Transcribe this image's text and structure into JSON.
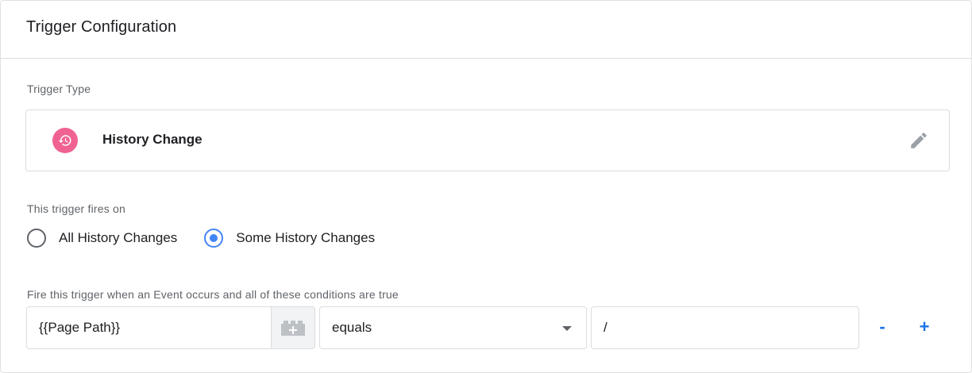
{
  "card": {
    "title": "Trigger Configuration"
  },
  "trigger_type": {
    "label": "Trigger Type",
    "name": "History Change",
    "icon": "history-icon",
    "icon_color": "#f06292",
    "edit_icon": "pencil-icon"
  },
  "fires_on": {
    "label": "This trigger fires on",
    "options": [
      {
        "label": "All History Changes",
        "checked": false
      },
      {
        "label": "Some History Changes",
        "checked": true
      }
    ]
  },
  "conditions": {
    "label": "Fire this trigger when an Event occurs and all of these conditions are true",
    "rows": [
      {
        "variable": "{{Page Path}}",
        "operator": "equals",
        "value": "/",
        "remove_label": "-",
        "add_label": "+"
      }
    ]
  },
  "colors": {
    "accent": "#1a73e8",
    "radio_checked": "#4285f4"
  }
}
